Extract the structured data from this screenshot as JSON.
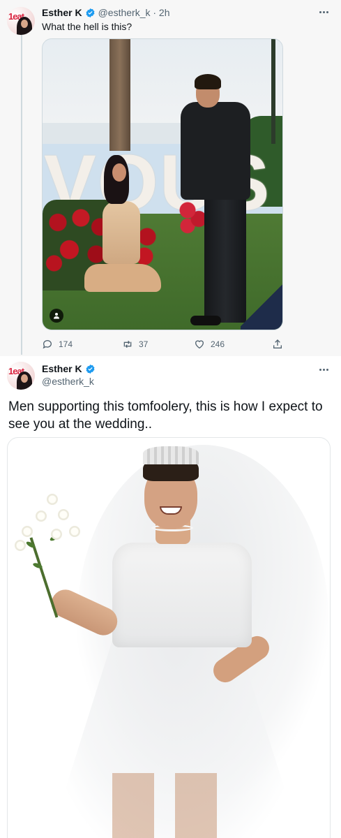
{
  "tweet1": {
    "author_name": "Esther K",
    "handle_time": "@estherk_k · 2h",
    "text": "What the hell is this?",
    "photo": {
      "sign_letters": [
        "V",
        "O",
        "U",
        "S"
      ]
    },
    "actions": {
      "reply_count": "174",
      "retweet_count": "37",
      "like_count": "246"
    }
  },
  "tweet2": {
    "author_name": "Esther K",
    "handle": "@estherk_k",
    "text": "Men supporting this tomfoolery, this is how I expect to see you at the wedding.."
  },
  "avatar": {
    "logo_text": "1eat"
  },
  "colors": {
    "verified": "#1d9bf0",
    "muted_text": "#536471",
    "thread_line": "#cfd9de",
    "quoted_bg": "#f7f7f7"
  },
  "icons": [
    "verified-badge-icon",
    "more-icon",
    "reply-icon",
    "retweet-icon",
    "like-icon",
    "share-icon",
    "person-tag-icon"
  ]
}
